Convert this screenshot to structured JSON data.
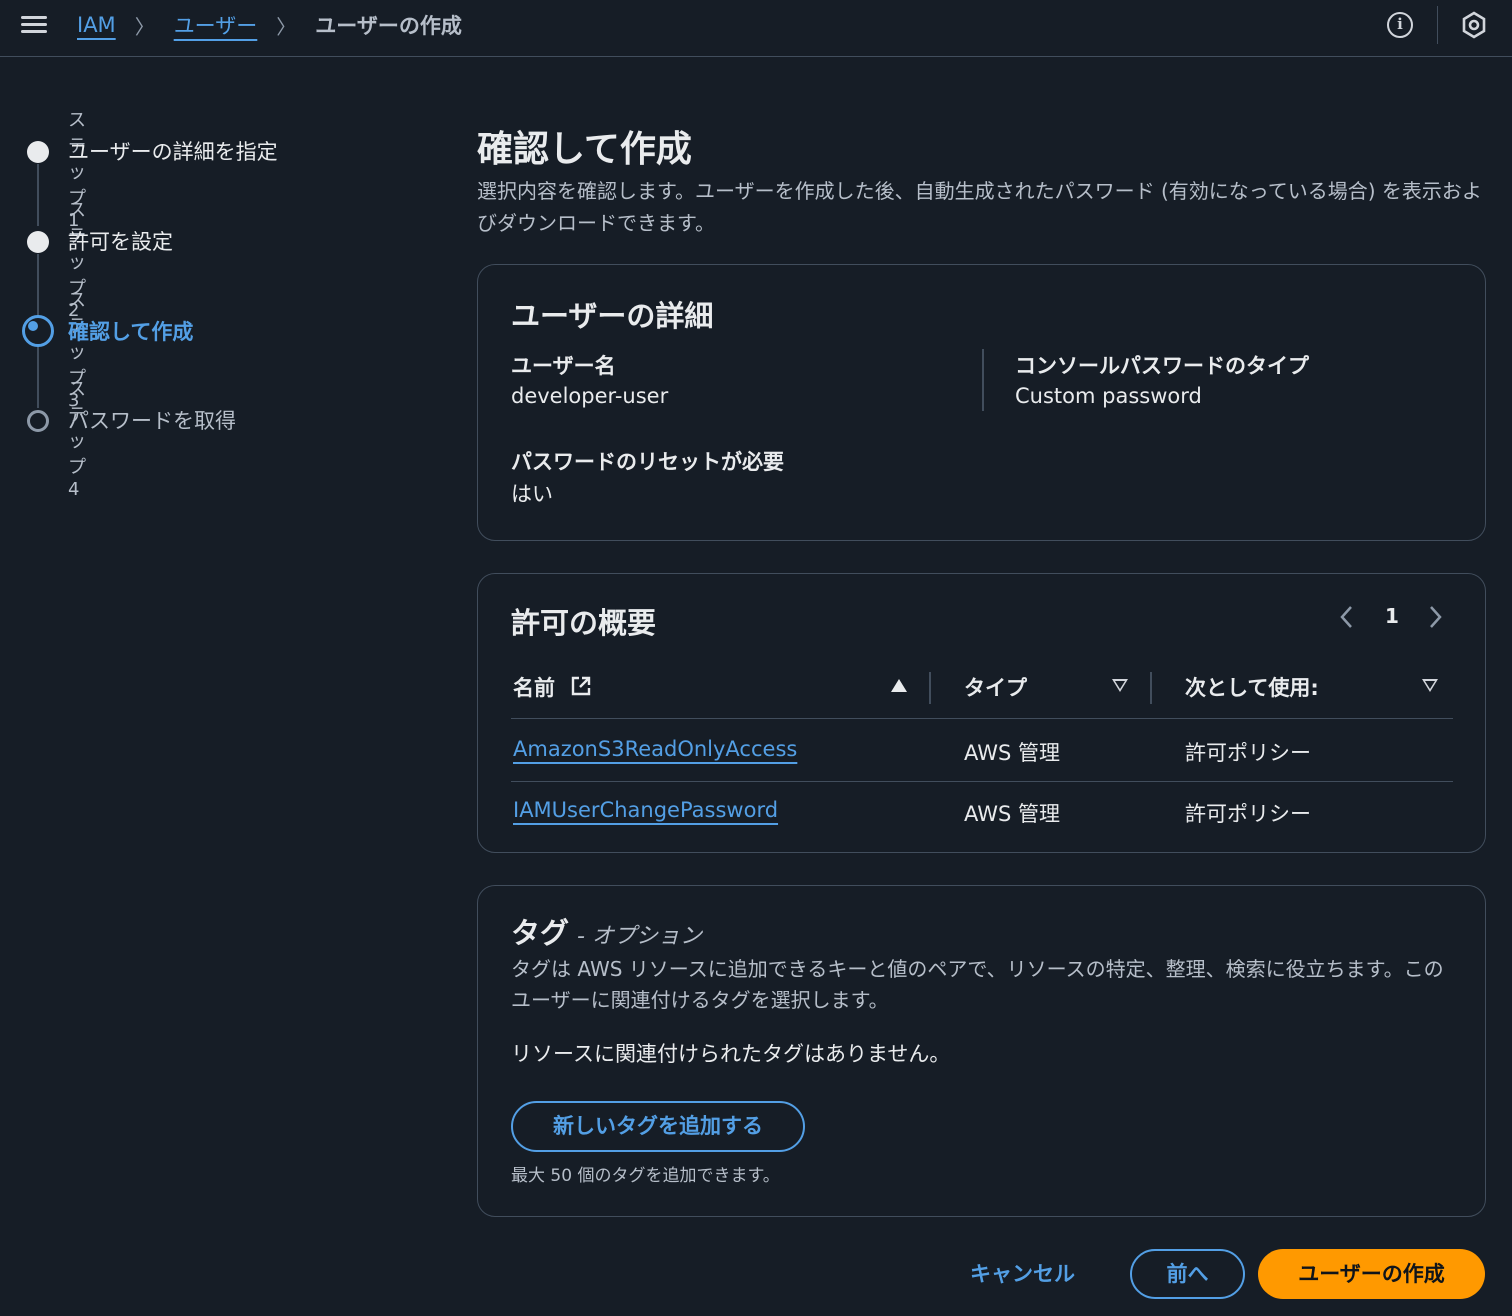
{
  "breadcrumb": {
    "root": "IAM",
    "users": "ユーザー",
    "current": "ユーザーの作成"
  },
  "steps": [
    {
      "label": "ステップ 1",
      "title": "ユーザーの詳細を指定",
      "state": "done"
    },
    {
      "label": "ステップ 2",
      "title": "許可を設定",
      "state": "done"
    },
    {
      "label": "ステップ 3",
      "title": "確認して作成",
      "state": "active"
    },
    {
      "label": "ステップ 4",
      "title": "パスワードを取得",
      "state": "todo"
    }
  ],
  "page": {
    "title": "確認して作成",
    "description": "選択内容を確認します。ユーザーを作成した後、自動生成されたパスワード (有効になっている場合) を表示およびダウンロードできます。"
  },
  "user_details": {
    "title": "ユーザーの詳細",
    "username_label": "ユーザー名",
    "username_value": "developer-user",
    "password_type_label": "コンソールパスワードのタイプ",
    "password_type_value": "Custom password",
    "reset_label": "パスワードのリセットが必要",
    "reset_value": "はい"
  },
  "permissions": {
    "title": "許可の概要",
    "page": "1",
    "columns": [
      "名前",
      "タイプ",
      "次として使用:"
    ],
    "rows": [
      {
        "name": "AmazonS3ReadOnlyAccess",
        "type": "AWS 管理",
        "used_as": "許可ポリシー"
      },
      {
        "name": "IAMUserChangePassword",
        "type": "AWS 管理",
        "used_as": "許可ポリシー"
      }
    ]
  },
  "tags": {
    "title": "タグ",
    "optional": "- オプション",
    "description": "タグは AWS リソースに追加できるキーと値のペアで、リソースの特定、整理、検索に役立ちます。このユーザーに関連付けるタグを選択します。",
    "empty": "リソースに関連付けられたタグはありません。",
    "add_button": "新しいタグを追加する",
    "note": "最大 50 個のタグを追加できます。"
  },
  "footer": {
    "cancel": "キャンセル",
    "previous": "前へ",
    "create": "ユーザーの作成"
  },
  "colors": {
    "background": "#161d26",
    "link": "#539fe5",
    "primary": "#ff9900",
    "border": "#414d5c"
  }
}
